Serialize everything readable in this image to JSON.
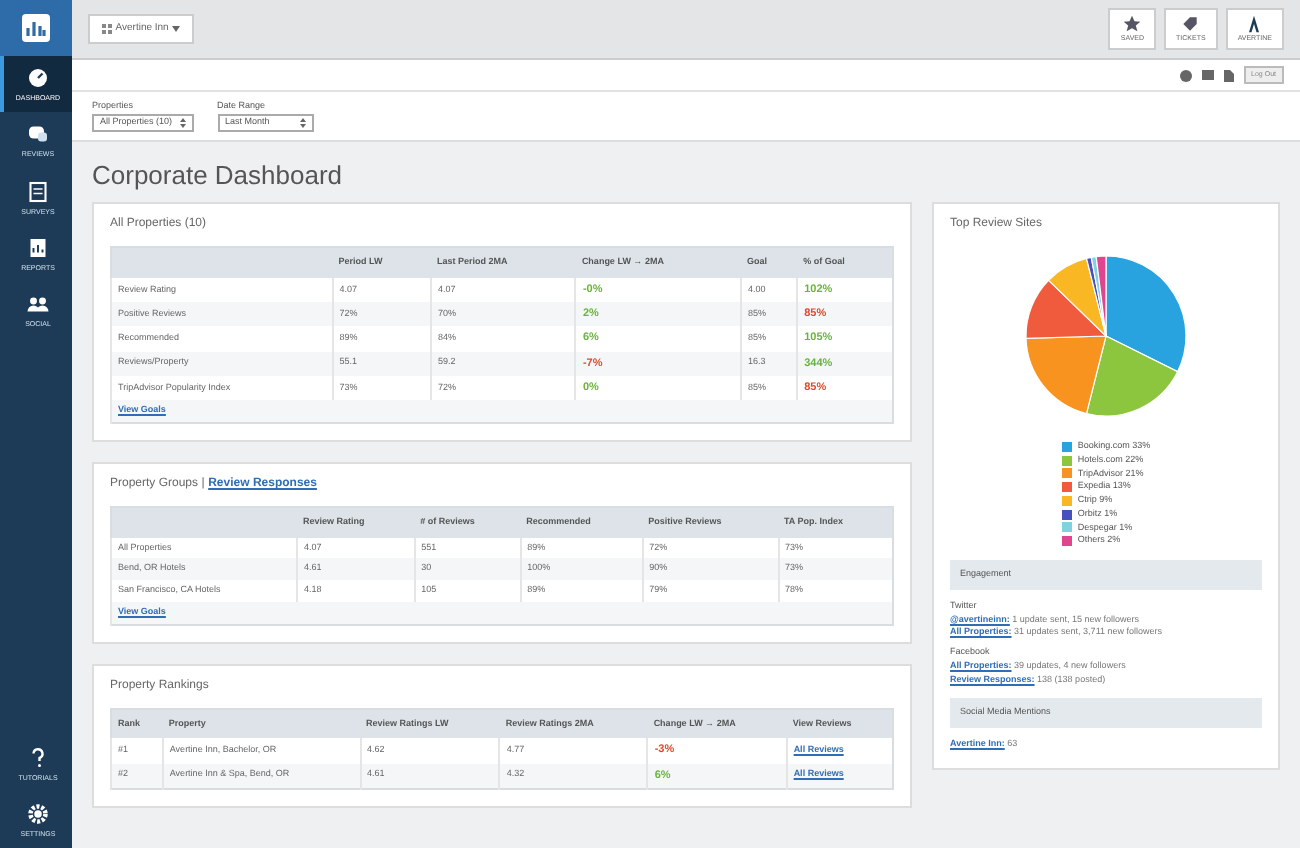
{
  "sidebar": {
    "items": [
      {
        "label": "DASHBOARD",
        "selected": true
      },
      {
        "label": "REVIEWS",
        "selected": false
      },
      {
        "label": "SURVEYS",
        "selected": false
      },
      {
        "label": "REPORTS",
        "selected": false
      },
      {
        "label": "SOCIAL",
        "selected": false
      }
    ],
    "bottom_items": [
      {
        "label": "TUTORIALS",
        "selected": false
      },
      {
        "label": "SETTINGS",
        "selected": false
      }
    ]
  },
  "top_bar": {
    "account_dropdown": "Avertine Inn",
    "buttons": [
      {
        "label": "SAVED"
      },
      {
        "label": "TICKETS"
      },
      {
        "label": "AVERTINE"
      }
    ]
  },
  "toolbar": {
    "button": "Log Out"
  },
  "filters": [
    {
      "label": "Properties",
      "value": "All Properties (10)"
    },
    {
      "label": "Date Range",
      "value": "Last Month"
    }
  ],
  "title": "Corporate Dashboard",
  "all_properties": {
    "title": "All Properties (10)",
    "columns": [
      "",
      "Period LW",
      "Last Period 2MA",
      "Change LW → 2MA",
      "Goal",
      "% of Goal"
    ],
    "rows": [
      {
        "metric": "Review Rating",
        "period": "4.07",
        "last_period": "4.07",
        "change": {
          "text": "-0%",
          "color": "#6bb43b"
        },
        "goal": "4.00",
        "pct_goal": {
          "text": "102%",
          "color": "#6bb43b"
        }
      },
      {
        "metric": "Positive Reviews",
        "period": "72%",
        "last_period": "70%",
        "change": {
          "text": "2%",
          "color": "#6bb43b"
        },
        "goal": "85%",
        "pct_goal": {
          "text": "85%",
          "color": "#e04a2a"
        }
      },
      {
        "metric": "Recommended",
        "period": "89%",
        "last_period": "84%",
        "change": {
          "text": "6%",
          "color": "#6bb43b"
        },
        "goal": "85%",
        "pct_goal": {
          "text": "105%",
          "color": "#6bb43b"
        }
      },
      {
        "metric": "Reviews/Property",
        "period": "55.1",
        "last_period": "59.2",
        "change": {
          "text": "-7%",
          "color": "#e04a2a"
        },
        "goal": "16.3",
        "pct_goal": {
          "text": "344%",
          "color": "#6bb43b"
        }
      },
      {
        "metric": "TripAdvisor Popularity Index",
        "period": "73%",
        "last_period": "72%",
        "change": {
          "text": "0%",
          "color": "#6bb43b"
        },
        "goal": "85%",
        "pct_goal": {
          "text": "85%",
          "color": "#e04a2a"
        }
      }
    ],
    "link": "View Goals"
  },
  "property_groups": {
    "title": "Property Groups",
    "separator": "|",
    "title_link": "Review Responses",
    "columns": [
      "",
      "Review Rating",
      "# of Reviews",
      "Recommended",
      "Positive Reviews",
      "TA Pop. Index"
    ],
    "rows": [
      [
        "All Properties",
        "4.07",
        "551",
        "89%",
        "72%",
        "73%"
      ],
      [
        "Bend, OR Hotels",
        "4.61",
        "30",
        "100%",
        "90%",
        "73%"
      ],
      [
        "San Francisco, CA Hotels",
        "4.18",
        "105",
        "89%",
        "79%",
        "78%"
      ]
    ],
    "link": "View Goals"
  },
  "property_rankings": {
    "title": "Property Rankings",
    "columns": [
      "Rank",
      "Property",
      "Review Ratings LW",
      "Review Ratings 2MA",
      "Change LW → 2MA",
      "View Reviews"
    ],
    "rows": [
      {
        "rank": "#1",
        "property": "Avertine Inn, Bachelor, OR",
        "lw": "4.62",
        "ma": "4.77",
        "change": {
          "text": "-3%",
          "color": "#e04a2a"
        },
        "link": "All Reviews"
      },
      {
        "rank": "#2",
        "property": "Avertine Inn & Spa, Bend, OR",
        "lw": "4.61",
        "ma": "4.32",
        "change": {
          "text": "6%",
          "color": "#6bb43b"
        },
        "link": "All Reviews"
      }
    ]
  },
  "top_review_sites": {
    "title": "Top Review Sites",
    "chart_data": {
      "type": "pie",
      "legend": "bottom",
      "categories": [
        "Booking.com 33%",
        "Hotels.com 22%",
        "TripAdvisor 21%",
        "Expedia 13%",
        "Ctrip 9%",
        "Orbitz 1%",
        "Despegar 1%",
        "Others 2%"
      ],
      "values": [
        33,
        22,
        21,
        13,
        9,
        1,
        1,
        2
      ],
      "colors": [
        "#29a3e0",
        "#8cc63f",
        "#f7931e",
        "#ef5b3c",
        "#f9b823",
        "#4a4fbf",
        "#7fd3de",
        "#e0458f"
      ]
    }
  },
  "engagement": {
    "title": "Engagement",
    "groups": [
      {
        "network": "Twitter",
        "lines": [
          {
            "link": "@avertineinn:",
            "text": "1 update sent, 15 new followers"
          },
          {
            "link": "All Properties:",
            "text": "31 updates sent, 3,711 new followers"
          }
        ]
      },
      {
        "network": "Facebook",
        "lines": [
          {
            "link": "All Properties:",
            "text": "39 updates, 4 new followers"
          },
          {
            "link": "Review Responses:",
            "text": "138 (138 posted)"
          }
        ]
      }
    ]
  },
  "social_mentions": {
    "title": "Social Media Mentions",
    "lines": [
      {
        "link": "Avertine Inn:",
        "text": "63"
      }
    ]
  }
}
